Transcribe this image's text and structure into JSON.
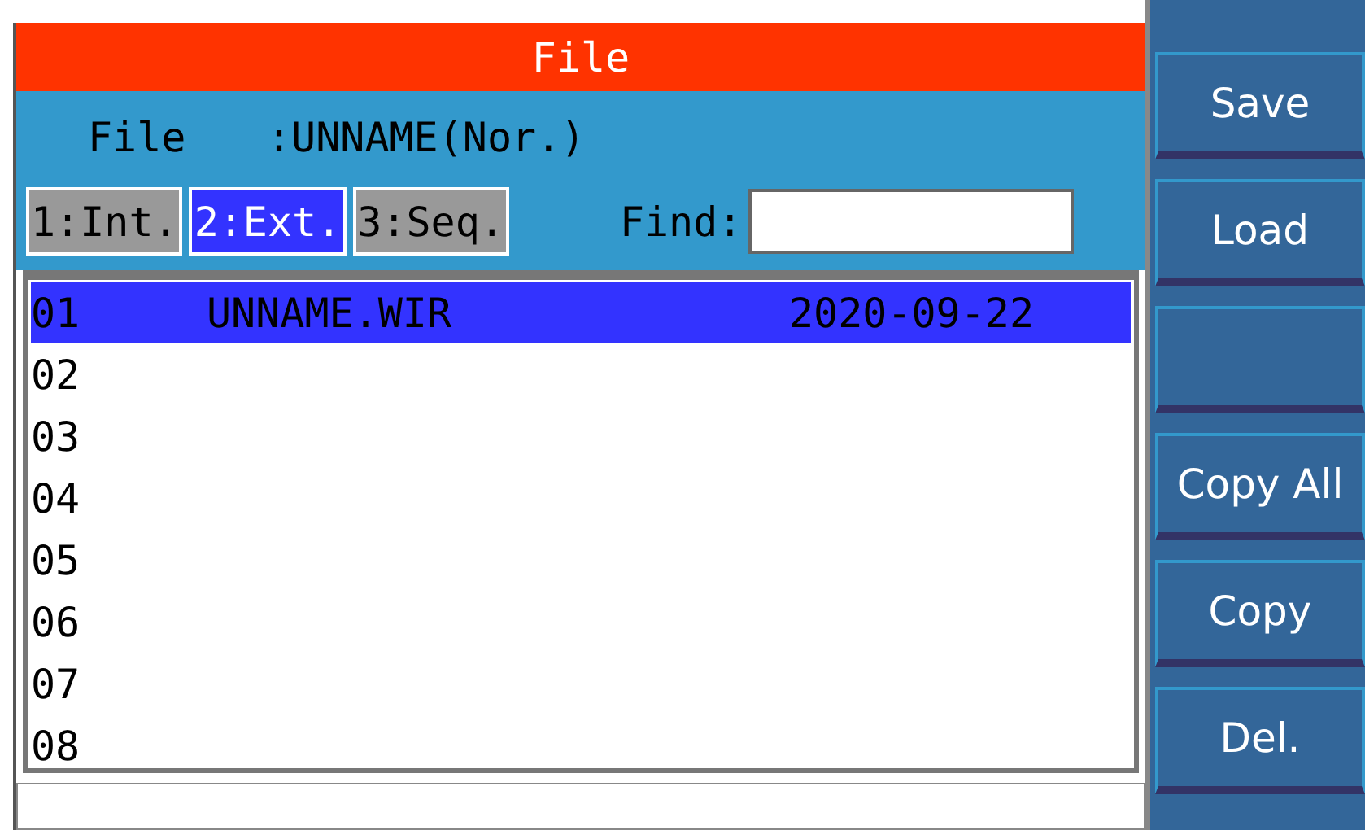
{
  "title": "File",
  "file_label": "File",
  "file_value": ":UNNAME(Nor.)",
  "tabs": [
    {
      "label": "1:Int.",
      "selected": false
    },
    {
      "label": "2:Ext.",
      "selected": true
    },
    {
      "label": "3:Seq.",
      "selected": false
    }
  ],
  "find_label": "Find:",
  "rows": [
    {
      "number": "01",
      "name": "UNNAME.WIR",
      "date": "2020-09-22",
      "selected": true
    },
    {
      "number": "02",
      "selected": false
    },
    {
      "number": "03",
      "selected": false
    },
    {
      "number": "04",
      "selected": false
    },
    {
      "number": "05",
      "selected": false
    },
    {
      "number": "06",
      "selected": false
    },
    {
      "number": "07",
      "selected": false
    },
    {
      "number": "08",
      "selected": false
    }
  ],
  "buttons": [
    {
      "kind": "label",
      "label": "Save"
    },
    {
      "kind": "label",
      "label": "Load"
    },
    {
      "kind": "blank"
    },
    {
      "kind": "label",
      "label": "Copy All"
    },
    {
      "kind": "label",
      "label": "Copy"
    },
    {
      "kind": "label",
      "label": "Del."
    }
  ]
}
